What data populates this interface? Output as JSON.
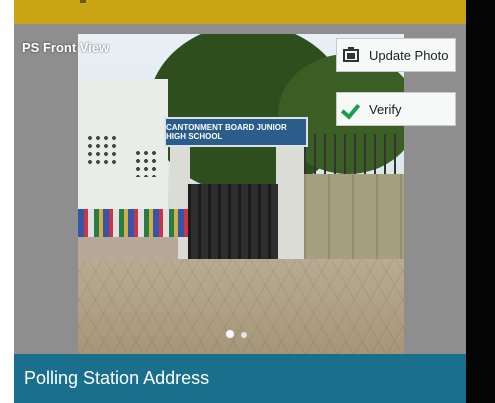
{
  "photo_viewer": {
    "caption": "PS Front View",
    "sign_text": "CANTONMENT BOARD JUNIOR HIGH SCHOOL",
    "page_indicator": {
      "count": 2,
      "active_index": 0
    }
  },
  "actions": {
    "update_photo_label": "Update Photo",
    "verify_label": "Verify"
  },
  "footer": {
    "section_title": "Polling Station Address"
  },
  "colors": {
    "status_bar": "#c9a414",
    "footer": "#1a6f8c",
    "verify_check": "#14a14a"
  },
  "icons": [
    "photo-update-icon",
    "checkmark-icon"
  ]
}
